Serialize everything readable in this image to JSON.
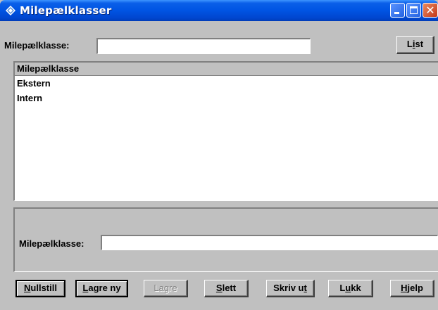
{
  "window": {
    "title": "Milepælklasser"
  },
  "search": {
    "label": "Milepælklasse:",
    "value": "",
    "list_button_pre": "L",
    "list_button_underline": "i",
    "list_button_post": "st"
  },
  "list": {
    "header": "Milepælklasse",
    "rows": [
      "Ekstern",
      "Intern"
    ]
  },
  "edit": {
    "label": "Milepælklasse:",
    "value": ""
  },
  "buttons": {
    "nullstill": {
      "u": "N",
      "rest": "ullstill"
    },
    "lagre_ny": {
      "u": "L",
      "rest": "agre ny"
    },
    "lagre": {
      "label": "Lagre",
      "disabled": true
    },
    "slett": {
      "u": "S",
      "rest": "lett"
    },
    "skriv_ut": {
      "pre": "Skriv u",
      "u": "t"
    },
    "lukk": {
      "pre": "L",
      "u": "u",
      "rest": "kk"
    },
    "hjelp": {
      "u": "H",
      "rest": "jelp"
    }
  },
  "icons": {
    "app": "notepad-diamond-icon",
    "minimize": "minimize-icon",
    "maximize": "maximize-icon",
    "close": "close-icon"
  },
  "colors": {
    "titlebar": "#0054e3",
    "face": "#c0c0c0",
    "close": "#c4381a"
  }
}
